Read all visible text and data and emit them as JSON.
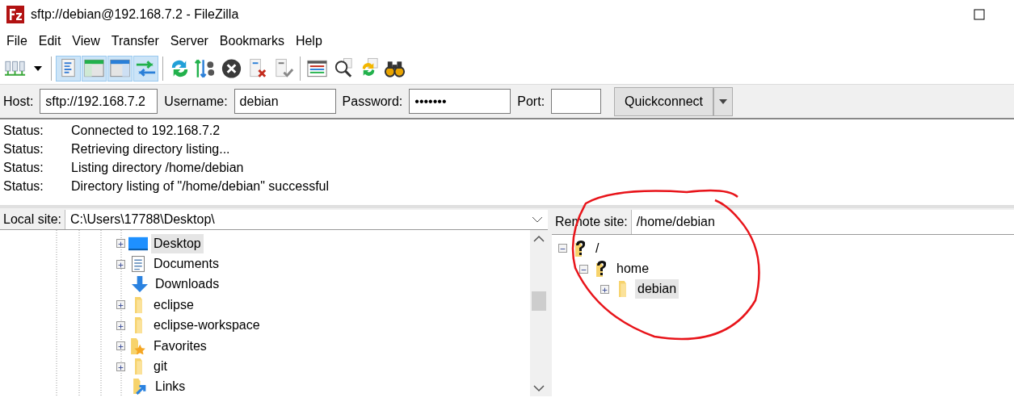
{
  "window": {
    "title": "sftp://debian@192.168.7.2 - FileZilla"
  },
  "menu": [
    "File",
    "Edit",
    "View",
    "Transfer",
    "Server",
    "Bookmarks",
    "Help"
  ],
  "toolbar": [
    [
      {
        "kind": "site-manager",
        "pressed": false
      },
      {
        "kind": "dropdown",
        "pressed": false
      }
    ],
    [
      {
        "kind": "log",
        "pressed": true
      },
      {
        "kind": "local-tree",
        "pressed": true
      },
      {
        "kind": "remote-tree",
        "pressed": true
      },
      {
        "kind": "queue",
        "pressed": true
      }
    ],
    [
      {
        "kind": "refresh",
        "pressed": false
      },
      {
        "kind": "filters",
        "pressed": false
      },
      {
        "kind": "cancel",
        "pressed": false
      },
      {
        "kind": "disconnect",
        "pressed": false
      },
      {
        "kind": "reconnect",
        "pressed": false
      }
    ],
    [
      {
        "kind": "listing",
        "pressed": false
      },
      {
        "kind": "search",
        "pressed": false
      },
      {
        "kind": "sync",
        "pressed": false
      },
      {
        "kind": "find",
        "pressed": false
      }
    ]
  ],
  "quickconnect": {
    "host_label": "Host:",
    "host": "sftp://192.168.7.2",
    "username_label": "Username:",
    "username": "debian",
    "password_label": "Password:",
    "password": "•••••••",
    "port_label": "Port:",
    "button": "Quickconnect"
  },
  "log": [
    {
      "label": "Status:",
      "message": "Connected to 192.168.7.2"
    },
    {
      "label": "Status:",
      "message": "Retrieving directory listing..."
    },
    {
      "label": "Status:",
      "message": "Listing directory /home/debian"
    },
    {
      "label": "Status:",
      "message": "Directory listing of \"/home/debian\" successful"
    }
  ],
  "local": {
    "label": "Local site:",
    "path": "C:\\Users\\17788\\Desktop\\",
    "items": [
      {
        "name": "Desktop",
        "kind": "desktop",
        "expandable": true,
        "selected": true
      },
      {
        "name": "Documents",
        "kind": "document",
        "expandable": true,
        "selected": false
      },
      {
        "name": "Downloads",
        "kind": "download",
        "expandable": false,
        "selected": false
      },
      {
        "name": "eclipse",
        "kind": "folder",
        "expandable": true,
        "selected": false
      },
      {
        "name": "eclipse-workspace",
        "kind": "folder",
        "expandable": true,
        "selected": false
      },
      {
        "name": "Favorites",
        "kind": "favorites",
        "expandable": true,
        "selected": false
      },
      {
        "name": "git",
        "kind": "folder",
        "expandable": true,
        "selected": false
      },
      {
        "name": "Links",
        "kind": "links",
        "expandable": false,
        "selected": false
      }
    ]
  },
  "remote": {
    "label": "Remote site:",
    "path": "/home/debian",
    "tree": [
      {
        "name": "/",
        "kind": "unknown",
        "expanded": true,
        "selected": false,
        "children": [
          {
            "name": "home",
            "kind": "unknown",
            "expanded": true,
            "selected": false,
            "children": [
              {
                "name": "debian",
                "kind": "folder",
                "expanded": false,
                "selected": true
              }
            ]
          }
        ]
      }
    ]
  }
}
